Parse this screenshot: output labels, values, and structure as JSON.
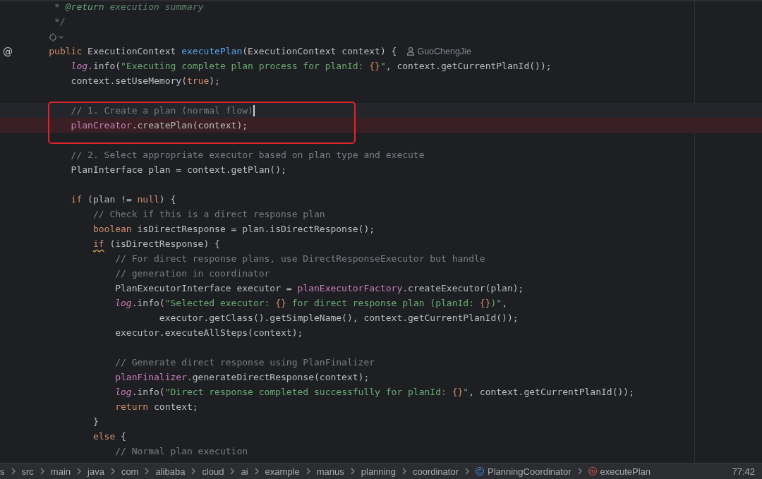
{
  "editor": {
    "lines": [
      {
        "kind": "code",
        "tokens": [
          {
            "kind": "doc",
            "text": " * "
          },
          {
            "kind": "doctag",
            "text": "@return"
          },
          {
            "kind": "doc",
            "text": " execution summary"
          }
        ]
      },
      {
        "kind": "code",
        "tokens": [
          {
            "kind": "doc",
            "text": " */"
          }
        ]
      },
      {
        "kind": "hint"
      },
      {
        "kind": "code",
        "gutter": "@",
        "author": "GuoChengJie",
        "tokens": [
          {
            "kind": "keyword",
            "text": "public"
          },
          {
            "kind": "plain",
            "text": " ExecutionContext "
          },
          {
            "kind": "decl",
            "text": "executePlan"
          },
          {
            "kind": "plain",
            "text": "(ExecutionContext context) {"
          }
        ],
        "children": [
          {
            "kind": "code",
            "tokens": [
              {
                "kind": "static",
                "text": "log"
              },
              {
                "kind": "plain",
                "text": ".info("
              },
              {
                "kind": "string",
                "text": "\"Executing complete plan process for planId: "
              },
              {
                "kind": "placeholder",
                "text": "{}"
              },
              {
                "kind": "string",
                "text": "\""
              },
              {
                "kind": "plain",
                "text": ", context.getCurrentPlanId());"
              }
            ]
          },
          {
            "kind": "code",
            "tokens": [
              {
                "kind": "plain",
                "text": "context.setUseMemory("
              },
              {
                "kind": "keyword",
                "text": "true"
              },
              {
                "kind": "plain",
                "text": ");"
              }
            ]
          },
          {
            "kind": "blank"
          },
          {
            "kind": "code",
            "current": true,
            "boxed": true,
            "caret": true,
            "tokens": [
              {
                "kind": "comment",
                "text": "// 1. Create a plan (normal flow)"
              }
            ]
          },
          {
            "kind": "code",
            "marked": true,
            "boxed": true,
            "tokens": [
              {
                "kind": "field",
                "text": "planCreator"
              },
              {
                "kind": "plain",
                "text": ".createPlan(context);"
              }
            ]
          },
          {
            "kind": "blank"
          },
          {
            "kind": "code",
            "tokens": [
              {
                "kind": "comment",
                "text": "// 2. Select appropriate executor based on plan type and execute"
              }
            ]
          },
          {
            "kind": "code",
            "tokens": [
              {
                "kind": "plain",
                "text": "PlanInterface plan = context.getPlan();"
              }
            ]
          },
          {
            "kind": "blank"
          },
          {
            "kind": "code",
            "tokens": [
              {
                "kind": "keyword",
                "text": "if"
              },
              {
                "kind": "plain",
                "text": " (plan != "
              },
              {
                "kind": "keyword",
                "text": "null"
              },
              {
                "kind": "plain",
                "text": ") {"
              }
            ],
            "children": [
              {
                "kind": "code",
                "tokens": [
                  {
                    "kind": "comment",
                    "text": "// Check if this is a direct response plan"
                  }
                ]
              },
              {
                "kind": "code",
                "tokens": [
                  {
                    "kind": "keyword",
                    "text": "boolean"
                  },
                  {
                    "kind": "plain",
                    "text": " isDirectResponse = plan.isDirectResponse();"
                  }
                ]
              },
              {
                "kind": "code",
                "tokens": [
                  {
                    "kind": "keyword",
                    "text": "if",
                    "warning": true
                  },
                  {
                    "kind": "plain",
                    "text": " (isDirectResponse) {"
                  }
                ],
                "children": [
                  {
                    "kind": "code",
                    "tokens": [
                      {
                        "kind": "comment",
                        "text": "// For direct response plans, use DirectResponseExecutor but handle"
                      }
                    ]
                  },
                  {
                    "kind": "code",
                    "tokens": [
                      {
                        "kind": "comment",
                        "text": "// generation in coordinator"
                      }
                    ]
                  },
                  {
                    "kind": "code",
                    "tokens": [
                      {
                        "kind": "plain",
                        "text": "PlanExecutorInterface executor = "
                      },
                      {
                        "kind": "field",
                        "text": "planExecutorFactory"
                      },
                      {
                        "kind": "plain",
                        "text": ".createExecutor(plan);"
                      }
                    ]
                  },
                  {
                    "kind": "code",
                    "tokens": [
                      {
                        "kind": "static",
                        "text": "log"
                      },
                      {
                        "kind": "plain",
                        "text": ".info("
                      },
                      {
                        "kind": "string",
                        "text": "\"Selected executor: "
                      },
                      {
                        "kind": "placeholder",
                        "text": "{}"
                      },
                      {
                        "kind": "string",
                        "text": " for direct response plan (planId: "
                      },
                      {
                        "kind": "placeholder",
                        "text": "{}"
                      },
                      {
                        "kind": "string",
                        "text": ")\""
                      },
                      {
                        "kind": "plain",
                        "text": ","
                      }
                    ]
                  },
                  {
                    "kind": "code",
                    "tokens": [
                      {
                        "kind": "plain",
                        "text": "        executor.getClass().getSimpleName(), context.getCurrentPlanId());"
                      }
                    ]
                  },
                  {
                    "kind": "code",
                    "tokens": [
                      {
                        "kind": "plain",
                        "text": "executor.executeAllSteps(context);"
                      }
                    ]
                  },
                  {
                    "kind": "blank"
                  },
                  {
                    "kind": "code",
                    "tokens": [
                      {
                        "kind": "comment",
                        "text": "// Generate direct response using PlanFinalizer"
                      }
                    ]
                  },
                  {
                    "kind": "code",
                    "tokens": [
                      {
                        "kind": "field",
                        "text": "planFinalizer"
                      },
                      {
                        "kind": "plain",
                        "text": ".generateDirectResponse(context);"
                      }
                    ]
                  },
                  {
                    "kind": "code",
                    "tokens": [
                      {
                        "kind": "static",
                        "text": "log"
                      },
                      {
                        "kind": "plain",
                        "text": ".info("
                      },
                      {
                        "kind": "string",
                        "text": "\"Direct response completed successfully for planId: "
                      },
                      {
                        "kind": "placeholder",
                        "text": "{}"
                      },
                      {
                        "kind": "string",
                        "text": "\""
                      },
                      {
                        "kind": "plain",
                        "text": ", context.getCurrentPlanId());"
                      }
                    ]
                  },
                  {
                    "kind": "code",
                    "tokens": [
                      {
                        "kind": "keyword",
                        "text": "return"
                      },
                      {
                        "kind": "plain",
                        "text": " context;"
                      }
                    ]
                  }
                ]
              },
              {
                "kind": "code",
                "tokens": [
                  {
                    "kind": "plain",
                    "text": "}"
                  }
                ]
              },
              {
                "kind": "code",
                "tokens": [
                  {
                    "kind": "keyword",
                    "text": "else"
                  },
                  {
                    "kind": "plain",
                    "text": " {"
                  }
                ],
                "children": [
                  {
                    "kind": "code",
                    "tokens": [
                      {
                        "kind": "comment",
                        "text": "// Normal plan execution"
                      }
                    ]
                  }
                ]
              }
            ]
          }
        ]
      }
    ]
  },
  "breadcrumbs": {
    "items": [
      {
        "label": "s"
      },
      {
        "label": "src"
      },
      {
        "label": "main"
      },
      {
        "label": "java"
      },
      {
        "label": "com"
      },
      {
        "label": "alibaba"
      },
      {
        "label": "cloud"
      },
      {
        "label": "ai"
      },
      {
        "label": "example"
      },
      {
        "label": "manus"
      },
      {
        "label": "planning"
      },
      {
        "label": "coordinator"
      },
      {
        "label": "PlanningCoordinator",
        "kind": "class",
        "badge": "C"
      },
      {
        "label": "executePlan",
        "kind": "method",
        "badge": "m"
      }
    ],
    "position": "77:42"
  }
}
